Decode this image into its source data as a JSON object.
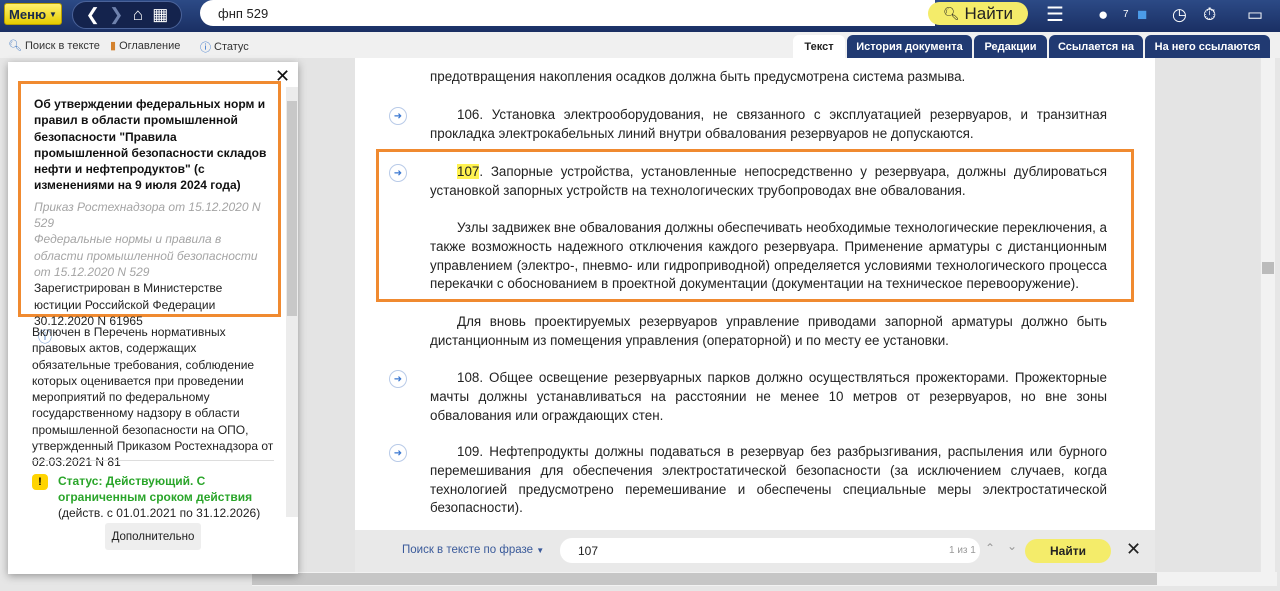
{
  "topbar": {
    "menu_label": "Меню",
    "search_value": "фнп 529",
    "find_label": "Найти",
    "badge_count": "7"
  },
  "toolbar": {
    "search_in_text": "Поиск в тексте",
    "contents": "Оглавление",
    "status": "Статус"
  },
  "tabs": [
    "Текст",
    "История документа",
    "Редакции",
    "Ссылается на",
    "На него ссылаются"
  ],
  "document": {
    "p0": "предотвращения накопления осадков должна быть предусмотрена система размыва.",
    "p106": "106. Установка электрооборудования, не связанного с эксплуатацией резервуаров, и транзитная прокладка электрокабельных линий внутри обвалования резервуаров не допускаются.",
    "p107_num": "107",
    "p107": ". Запорные устройства, установленные непосредственно у резервуара, должны дублироваться установкой запорных устройств на технологических трубопроводах вне обвалования.",
    "p107b": "Узлы задвижек вне обвалования должны обеспечивать необходимые технологические переключения, а также возможность надежного отключения каждого резервуара. Применение арматуры с дистанционным управлением (электро-, пневмо- или гидроприводной) определяется условиями технологического процесса перекачки с обоснованием в проектной документации (документации на техническое перевооружение).",
    "p107c": "Для вновь проектируемых резервуаров управление приводами запорной арматуры должно быть дистанционным из помещения управления (операторной) и по месту ее установки.",
    "p108": "108. Общее освещение резервуарных парков должно осуществляться прожекторами. Прожекторные мачты должны устанавливаться на расстоянии не менее 10 метров от резервуаров, но вне зоны обвалования или ограждающих стен.",
    "p109": "109. Нефтепродукты должны подаваться в резервуар без разбрызгивания, распыления или бурного перемешивания для обеспечения электростатической безопасности (за исключением случаев, когда технологией предусмотрено перемешивание и обеспечены специальные меры электростатической безопасности)."
  },
  "findbar": {
    "mode": "Поиск в тексте по фразе",
    "query": "107",
    "counter": "1 из 1",
    "find_label": "Найти"
  },
  "panel": {
    "title": "Об утверждении федеральных норм и правил в области промышленной безопасности \"Правила промышленной безопасности складов нефти и нефтепродуктов\" (с изменениями на 9 июля 2024 года)",
    "order": "Приказ Ростехнадзора от 15.12.2020 N 529",
    "fnp": "Федеральные нормы и правила в области промышленной безопасности от 15.12.2020 N 529",
    "registered": "Зарегистрирован в Министерстве юстиции Российской Федерации 30.12.2020 N 61965",
    "included": "Включен в Перечень нормативных правовых актов, содержащих обязательные требования, соблюдение которых оценивается при проведении мероприятий по федеральному государственному надзору в области промышленной безопасности на ОПО, утвержденный Приказом Ростехнадзора от 02.03.2021 N 81",
    "status": "Статус: Действующий. С ограниченным сроком действия",
    "validity": "(действ. с 01.01.2021 по 31.12.2026)",
    "more_label": "Дополнительно"
  },
  "colors": {
    "accent": "#f08a30",
    "nav": "#213a72",
    "status_green": "#2aa52a",
    "highlight": "#fff250"
  }
}
